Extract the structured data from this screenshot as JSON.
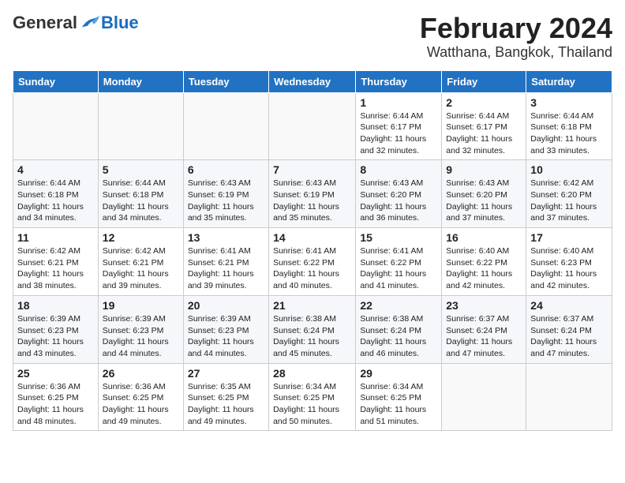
{
  "header": {
    "logo_general": "General",
    "logo_blue": "Blue",
    "month_title": "February 2024",
    "location": "Watthana, Bangkok, Thailand"
  },
  "days_of_week": [
    "Sunday",
    "Monday",
    "Tuesday",
    "Wednesday",
    "Thursday",
    "Friday",
    "Saturday"
  ],
  "weeks": [
    [
      {
        "day": "",
        "info": ""
      },
      {
        "day": "",
        "info": ""
      },
      {
        "day": "",
        "info": ""
      },
      {
        "day": "",
        "info": ""
      },
      {
        "day": "1",
        "info": "Sunrise: 6:44 AM\nSunset: 6:17 PM\nDaylight: 11 hours and 32 minutes."
      },
      {
        "day": "2",
        "info": "Sunrise: 6:44 AM\nSunset: 6:17 PM\nDaylight: 11 hours and 32 minutes."
      },
      {
        "day": "3",
        "info": "Sunrise: 6:44 AM\nSunset: 6:18 PM\nDaylight: 11 hours and 33 minutes."
      }
    ],
    [
      {
        "day": "4",
        "info": "Sunrise: 6:44 AM\nSunset: 6:18 PM\nDaylight: 11 hours and 34 minutes."
      },
      {
        "day": "5",
        "info": "Sunrise: 6:44 AM\nSunset: 6:18 PM\nDaylight: 11 hours and 34 minutes."
      },
      {
        "day": "6",
        "info": "Sunrise: 6:43 AM\nSunset: 6:19 PM\nDaylight: 11 hours and 35 minutes."
      },
      {
        "day": "7",
        "info": "Sunrise: 6:43 AM\nSunset: 6:19 PM\nDaylight: 11 hours and 35 minutes."
      },
      {
        "day": "8",
        "info": "Sunrise: 6:43 AM\nSunset: 6:20 PM\nDaylight: 11 hours and 36 minutes."
      },
      {
        "day": "9",
        "info": "Sunrise: 6:43 AM\nSunset: 6:20 PM\nDaylight: 11 hours and 37 minutes."
      },
      {
        "day": "10",
        "info": "Sunrise: 6:42 AM\nSunset: 6:20 PM\nDaylight: 11 hours and 37 minutes."
      }
    ],
    [
      {
        "day": "11",
        "info": "Sunrise: 6:42 AM\nSunset: 6:21 PM\nDaylight: 11 hours and 38 minutes."
      },
      {
        "day": "12",
        "info": "Sunrise: 6:42 AM\nSunset: 6:21 PM\nDaylight: 11 hours and 39 minutes."
      },
      {
        "day": "13",
        "info": "Sunrise: 6:41 AM\nSunset: 6:21 PM\nDaylight: 11 hours and 39 minutes."
      },
      {
        "day": "14",
        "info": "Sunrise: 6:41 AM\nSunset: 6:22 PM\nDaylight: 11 hours and 40 minutes."
      },
      {
        "day": "15",
        "info": "Sunrise: 6:41 AM\nSunset: 6:22 PM\nDaylight: 11 hours and 41 minutes."
      },
      {
        "day": "16",
        "info": "Sunrise: 6:40 AM\nSunset: 6:22 PM\nDaylight: 11 hours and 42 minutes."
      },
      {
        "day": "17",
        "info": "Sunrise: 6:40 AM\nSunset: 6:23 PM\nDaylight: 11 hours and 42 minutes."
      }
    ],
    [
      {
        "day": "18",
        "info": "Sunrise: 6:39 AM\nSunset: 6:23 PM\nDaylight: 11 hours and 43 minutes."
      },
      {
        "day": "19",
        "info": "Sunrise: 6:39 AM\nSunset: 6:23 PM\nDaylight: 11 hours and 44 minutes."
      },
      {
        "day": "20",
        "info": "Sunrise: 6:39 AM\nSunset: 6:23 PM\nDaylight: 11 hours and 44 minutes."
      },
      {
        "day": "21",
        "info": "Sunrise: 6:38 AM\nSunset: 6:24 PM\nDaylight: 11 hours and 45 minutes."
      },
      {
        "day": "22",
        "info": "Sunrise: 6:38 AM\nSunset: 6:24 PM\nDaylight: 11 hours and 46 minutes."
      },
      {
        "day": "23",
        "info": "Sunrise: 6:37 AM\nSunset: 6:24 PM\nDaylight: 11 hours and 47 minutes."
      },
      {
        "day": "24",
        "info": "Sunrise: 6:37 AM\nSunset: 6:24 PM\nDaylight: 11 hours and 47 minutes."
      }
    ],
    [
      {
        "day": "25",
        "info": "Sunrise: 6:36 AM\nSunset: 6:25 PM\nDaylight: 11 hours and 48 minutes."
      },
      {
        "day": "26",
        "info": "Sunrise: 6:36 AM\nSunset: 6:25 PM\nDaylight: 11 hours and 49 minutes."
      },
      {
        "day": "27",
        "info": "Sunrise: 6:35 AM\nSunset: 6:25 PM\nDaylight: 11 hours and 49 minutes."
      },
      {
        "day": "28",
        "info": "Sunrise: 6:34 AM\nSunset: 6:25 PM\nDaylight: 11 hours and 50 minutes."
      },
      {
        "day": "29",
        "info": "Sunrise: 6:34 AM\nSunset: 6:25 PM\nDaylight: 11 hours and 51 minutes."
      },
      {
        "day": "",
        "info": ""
      },
      {
        "day": "",
        "info": ""
      }
    ]
  ]
}
